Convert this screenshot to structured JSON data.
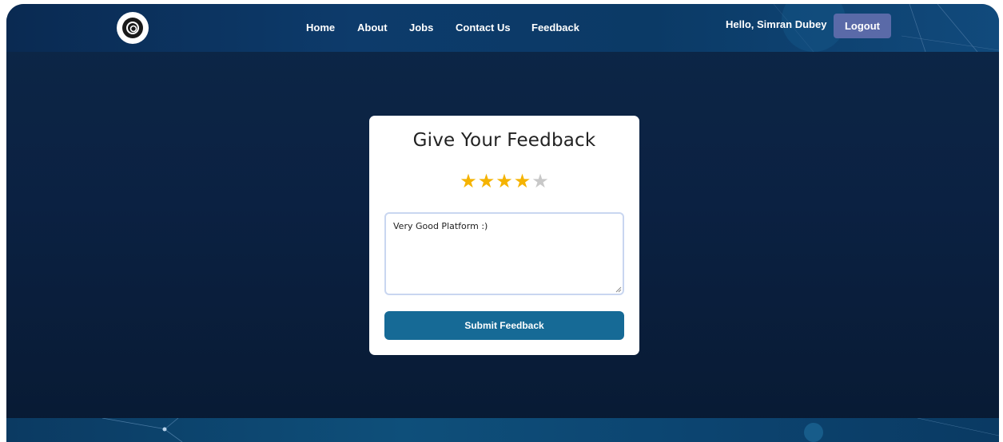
{
  "header": {
    "logo_icon": "cg-logo-icon",
    "nav": [
      {
        "label": "Home"
      },
      {
        "label": "About"
      },
      {
        "label": "Jobs"
      },
      {
        "label": "Contact Us"
      },
      {
        "label": "Feedback"
      }
    ],
    "greeting": "Hello, Simran Dubey",
    "logout_label": "Logout"
  },
  "feedback": {
    "title": "Give Your Feedback",
    "rating": 4,
    "max_rating": 5,
    "star_icon": "star-icon",
    "text_value": "Very Good Platform :)",
    "submit_label": "Submit Feedback"
  },
  "colors": {
    "accent_star": "#f5b301",
    "submit_button": "#166a96",
    "logout_button": "#5a6aa8",
    "background": "#0b2142"
  }
}
